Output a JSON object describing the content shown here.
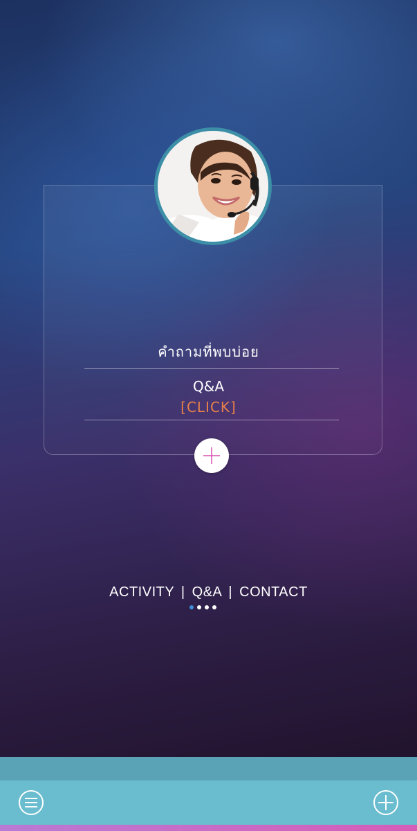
{
  "card": {
    "title": "คำถามที่พบบ่อย",
    "subtitle": "Q&A",
    "link": "[CLICK]",
    "link_color": "#e8804a"
  },
  "avatar": {
    "alt": "customer support agent with headset"
  },
  "nav": {
    "links": [
      "ACTIVITY",
      "Q&A",
      "CONTACT"
    ],
    "separator": "|",
    "active_page": 1,
    "page_count": 4
  },
  "bottom_bar": {
    "menu_icon": "menu-icon",
    "add_icon": "plus-circle-icon",
    "bar_color": "#6abccf",
    "strip_color": "#5aa2b5"
  },
  "colors": {
    "accent_blue": "#3f8ed8",
    "avatar_ring": "#3d8fa7"
  }
}
